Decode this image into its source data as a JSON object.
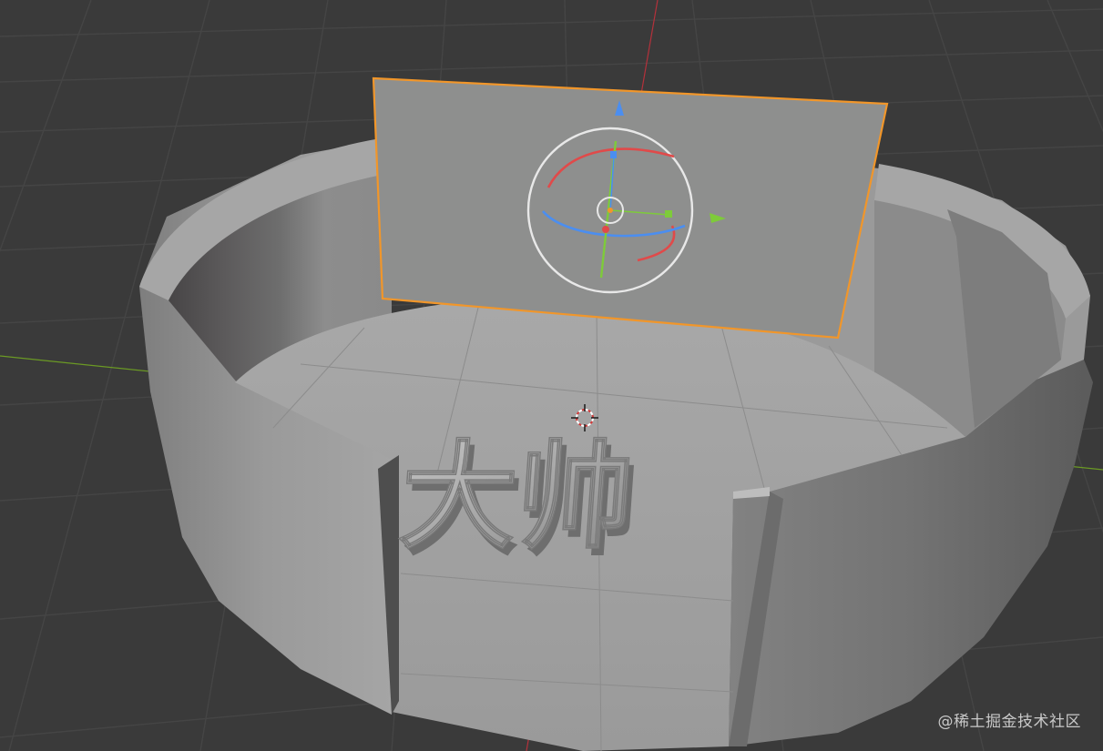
{
  "viewport": {
    "extruded_text": "大帅",
    "watermark": "@稀土掘金技术社区",
    "colors": {
      "background": "#3a3a3a",
      "grid": "#454545",
      "x_axis": "#b4313b",
      "y_axis": "#6b9a24",
      "selection_outline": "#f1962a",
      "mesh_light": "#9c9c9c",
      "mesh_dark": "#5a5a5a",
      "plane": "#8e8f8e",
      "gizmo_x": "#e04a4a",
      "gizmo_y": "#7ecb3a",
      "gizmo_z": "#4b8ef0",
      "gizmo_trackball": "#e8e8e8"
    },
    "icons": [
      "rotate-gizmo-icon",
      "3d-cursor-icon",
      "z-axis-arrow-icon",
      "y-axis-arrow-icon"
    ]
  }
}
